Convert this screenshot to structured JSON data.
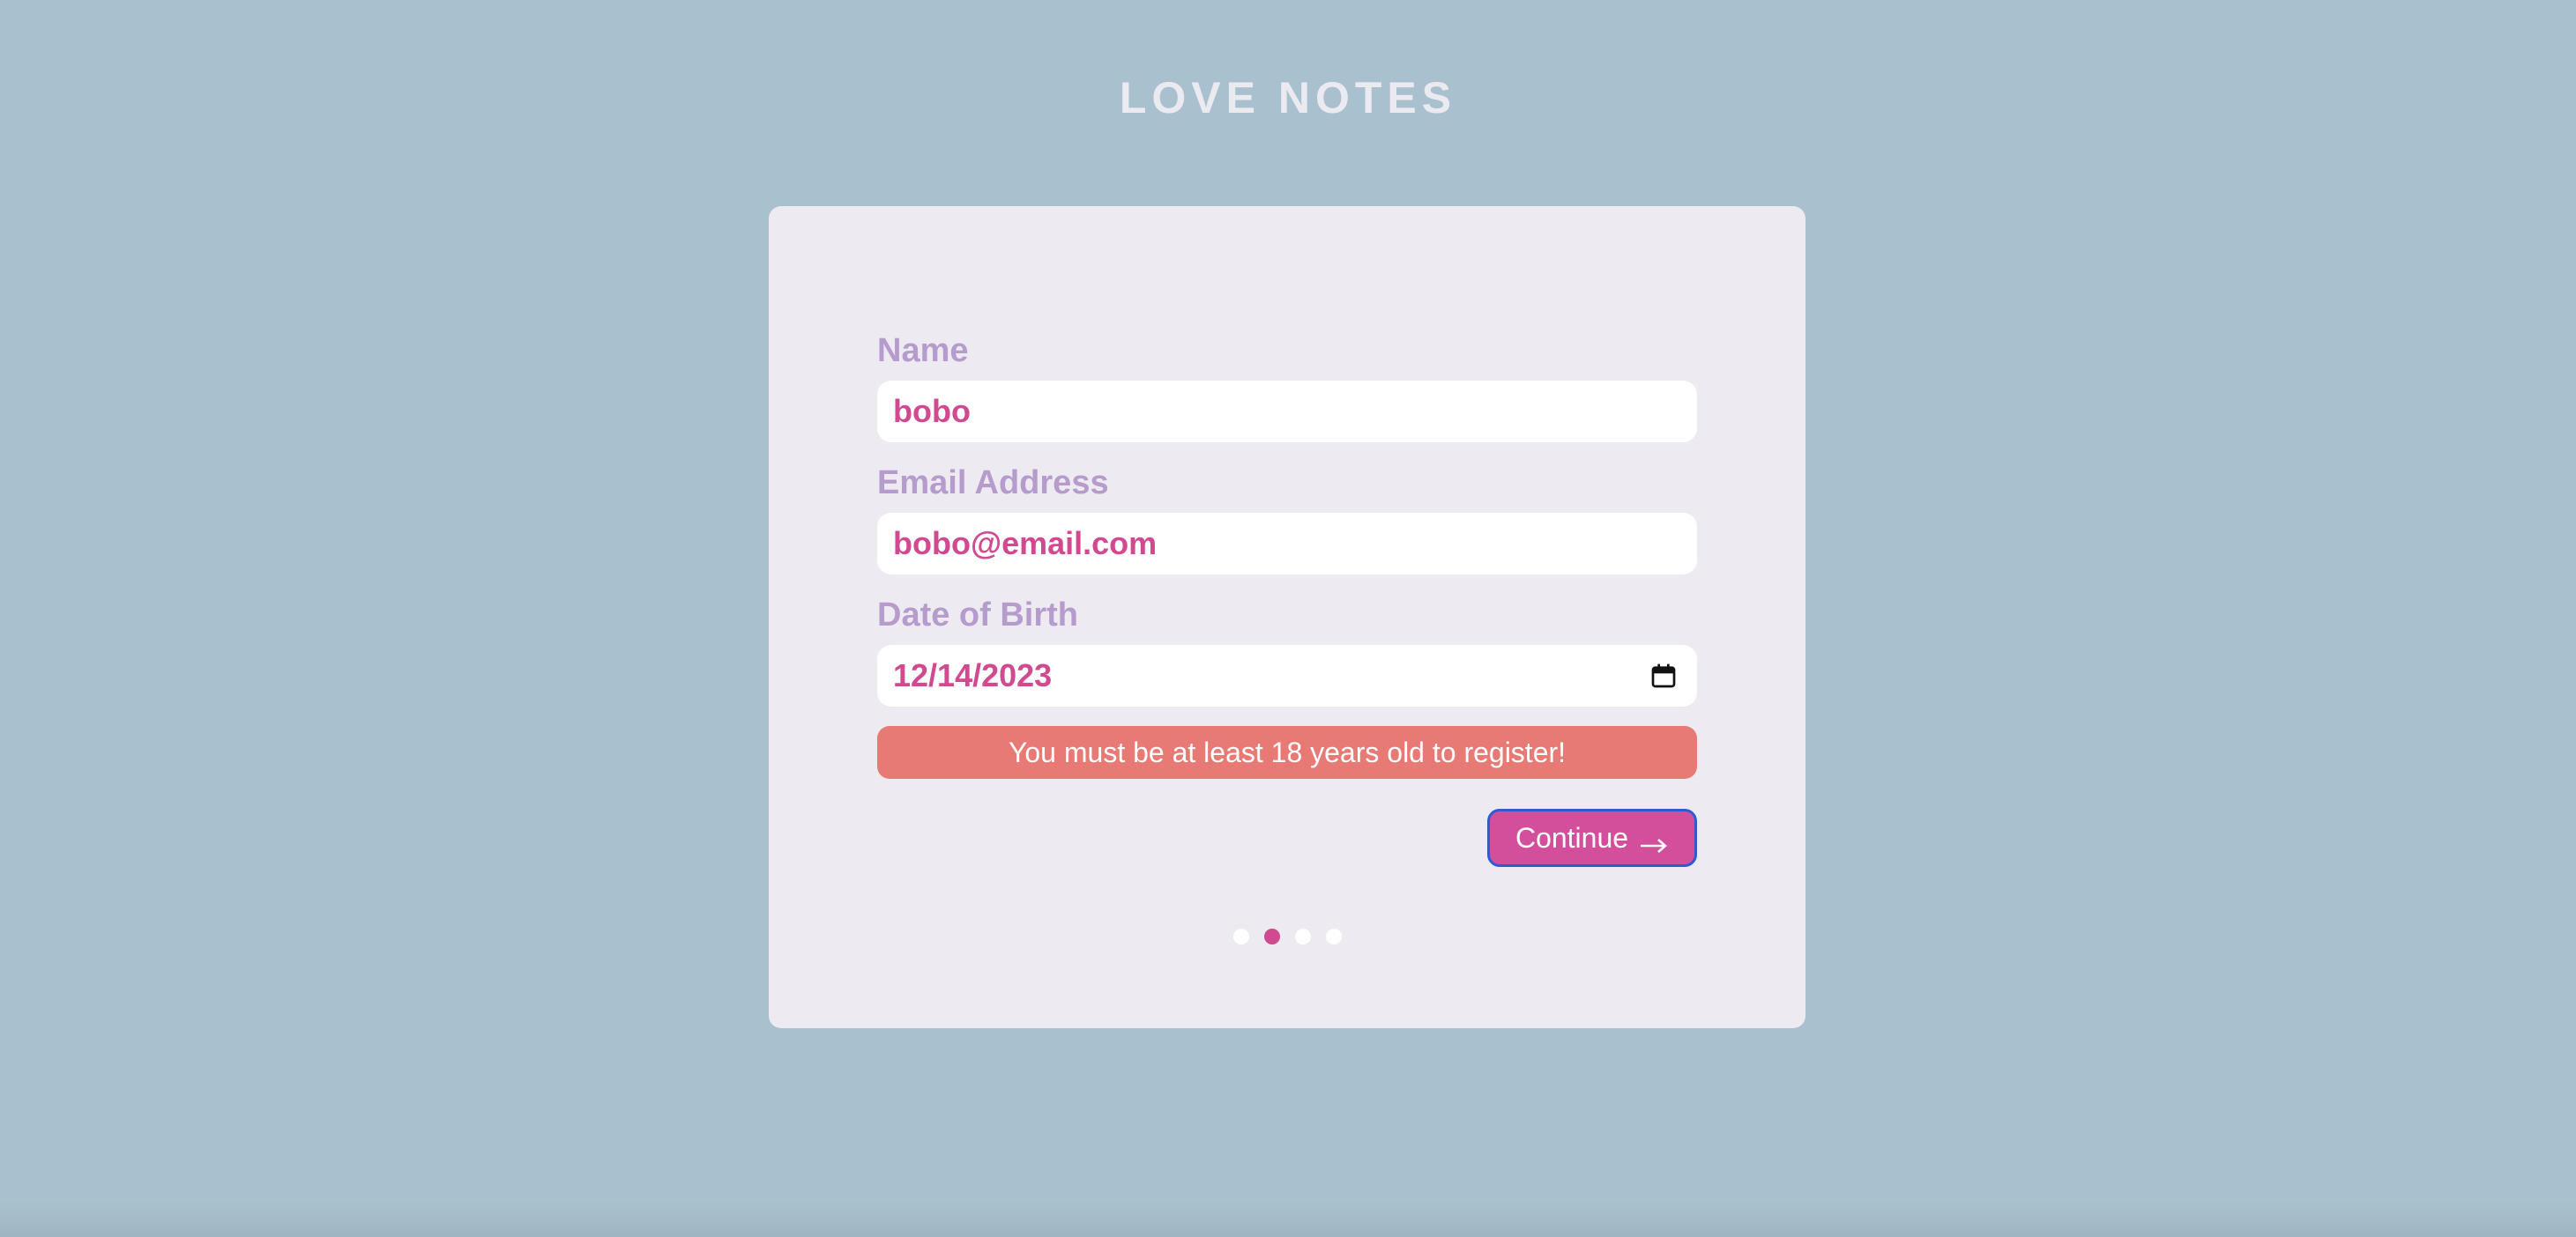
{
  "app": {
    "title": "LOVE NOTES"
  },
  "form": {
    "name": {
      "label": "Name",
      "value": "bobo"
    },
    "email": {
      "label": "Email Address",
      "value": "bobo@email.com"
    },
    "dob": {
      "label": "Date of Birth",
      "value": "12/14/2023",
      "icon": "calendar-icon"
    },
    "error_message": "You must be at least 18 years old to register!",
    "continue_label": "Continue",
    "continue_icon": "arrow-right-icon"
  },
  "steps": {
    "total": 4,
    "current": 2
  },
  "colors": {
    "background": "#a9c1ce",
    "card": "#edeaf1",
    "label": "#b59ccc",
    "value": "#d1498f",
    "error": "#e77a74",
    "button": "#d44f9b",
    "button_focus_border": "#2d5bd6"
  }
}
